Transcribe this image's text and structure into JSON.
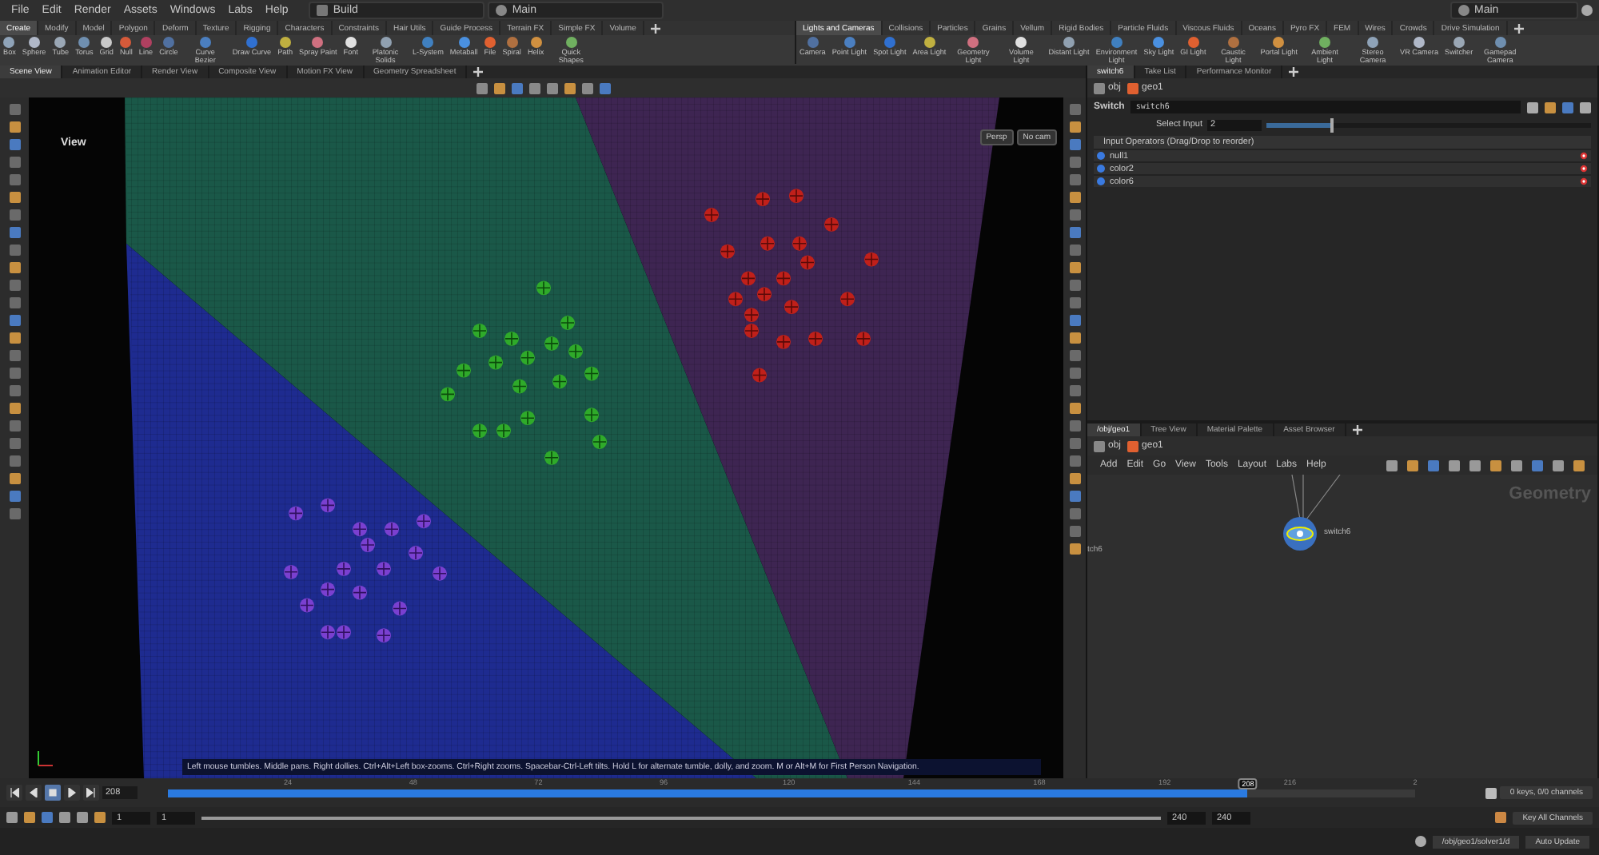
{
  "menu_bar": {
    "items": [
      "File",
      "Edit",
      "Render",
      "Assets",
      "Windows",
      "Labs",
      "Help"
    ],
    "desktop": "Build",
    "context": "Main",
    "right_context": "Main"
  },
  "shelf_left": {
    "tabs": [
      {
        "label": "Create",
        "selected": true
      },
      {
        "label": "Modify",
        "selected": false
      },
      {
        "label": "Model",
        "selected": false
      },
      {
        "label": "Polygon",
        "selected": false
      },
      {
        "label": "Deform",
        "selected": false
      },
      {
        "label": "Texture",
        "selected": false
      },
      {
        "label": "Rigging",
        "selected": false
      },
      {
        "label": "Characters",
        "selected": false
      },
      {
        "label": "Constraints",
        "selected": false
      },
      {
        "label": "Hair Utils",
        "selected": false
      },
      {
        "label": "Guide Process",
        "selected": false
      },
      {
        "label": "Terrain FX",
        "selected": false
      },
      {
        "label": "Simple FX",
        "selected": false
      },
      {
        "label": "Volume",
        "selected": false
      }
    ],
    "tools": [
      "Box",
      "Sphere",
      "Tube",
      "Torus",
      "Grid",
      "Null",
      "Line",
      "Circle",
      "Curve Bezier",
      "Draw Curve",
      "Path",
      "Spray Paint",
      "Font",
      "Platonic Solids",
      "L-System",
      "Metaball",
      "File",
      "Spiral",
      "Helix",
      "Quick Shapes"
    ]
  },
  "shelf_right": {
    "tabs": [
      {
        "label": "Lights and Cameras",
        "selected": true
      },
      {
        "label": "Collisions",
        "selected": false
      },
      {
        "label": "Particles",
        "selected": false
      },
      {
        "label": "Grains",
        "selected": false
      },
      {
        "label": "Vellum",
        "selected": false
      },
      {
        "label": "Rigid Bodies",
        "selected": false
      },
      {
        "label": "Particle Fluids",
        "selected": false
      },
      {
        "label": "Viscous Fluids",
        "selected": false
      },
      {
        "label": "Oceans",
        "selected": false
      },
      {
        "label": "Pyro FX",
        "selected": false
      },
      {
        "label": "FEM",
        "selected": false
      },
      {
        "label": "Wires",
        "selected": false
      },
      {
        "label": "Crowds",
        "selected": false
      },
      {
        "label": "Drive Simulation",
        "selected": false
      }
    ],
    "tools": [
      "Camera",
      "Point Light",
      "Spot Light",
      "Area Light",
      "Geometry Light",
      "Volume Light",
      "Distant Light",
      "Environment Light",
      "Sky Light",
      "GI Light",
      "Caustic Light",
      "Portal Light",
      "Ambient Light",
      "Stereo Camera",
      "VR Camera",
      "Switcher",
      "Gamepad Camera"
    ]
  },
  "viewer_tabs": [
    {
      "label": "Scene View",
      "selected": true
    },
    {
      "label": "Animation Editor",
      "selected": false
    },
    {
      "label": "Render View",
      "selected": false
    },
    {
      "label": "Composite View",
      "selected": false
    },
    {
      "label": "Motion FX View",
      "selected": false
    },
    {
      "label": "Geometry Spreadsheet",
      "selected": false
    }
  ],
  "viewport": {
    "title": "View",
    "camera_menus": [
      "Persp",
      "No cam"
    ],
    "help_text": "Left mouse tumbles. Middle pans. Right dollies. Ctrl+Alt+Left box-zooms. Ctrl+Right zooms. Spacebar-Ctrl-Left tilts. Hold L for alternate tumble, dolly, and zoom. M or Alt+M for First Person Navigation."
  },
  "parm_tabs": [
    {
      "label": "switch6",
      "selected": true
    },
    {
      "label": "Take List",
      "selected": false
    },
    {
      "label": "Performance Monitor",
      "selected": false
    }
  ],
  "parm_path": [
    "obj",
    "geo1"
  ],
  "parm": {
    "node_type": "Switch",
    "node_name": "switch6",
    "select_input_label": "Select Input",
    "select_input_value": "2",
    "level": 0.2,
    "inputs_header": "Input Operators (Drag/Drop to reorder)",
    "inputs": [
      "null1",
      "color2",
      "color6"
    ]
  },
  "network_tabs": [
    {
      "label": "/obj/geo1",
      "selected": true
    },
    {
      "label": "Tree View",
      "selected": false
    },
    {
      "label": "Material Palette",
      "selected": false
    },
    {
      "label": "Asset Browser",
      "selected": false
    }
  ],
  "network_path": [
    "obj",
    "geo1"
  ],
  "network_menu": [
    "Add",
    "Edit",
    "Go",
    "View",
    "Tools",
    "Layout",
    "Labs",
    "Help"
  ],
  "network": {
    "context_label": "Geometry",
    "node_label": "switch6",
    "cut_label": "tch6"
  },
  "timeline": {
    "current_frame": "208",
    "level": 0.866,
    "marker": "208",
    "ticks": [
      "24",
      "48",
      "72",
      "96",
      "120",
      "144",
      "168",
      "192",
      "216",
      "2"
    ]
  },
  "range": {
    "level": 1,
    "start": "1",
    "start_visible": "1",
    "end_visible": "240",
    "end": "240"
  },
  "keys": {
    "channels": "0 keys, 0/0 channels",
    "key_all": "Key All Channels"
  },
  "status": {
    "path": "/obj/geo1/solver1/d",
    "update_mode": "Auto Update"
  }
}
